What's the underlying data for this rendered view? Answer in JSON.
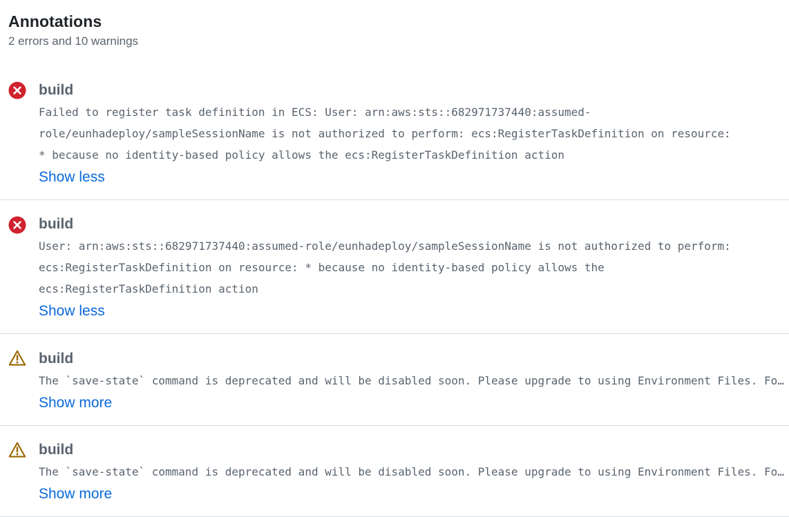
{
  "header": {
    "title": "Annotations",
    "summary": "2 errors and 10 warnings"
  },
  "colors": {
    "error": "#cf222e",
    "warning": "#9a6700",
    "link": "#0969da",
    "muted": "#59636e",
    "divider": "#d8dee4"
  },
  "annotations": [
    {
      "level": "error",
      "icon": "x-circle-fill-icon",
      "name": "build",
      "message_lines": [
        "Failed to register task definition in ECS: User: arn:aws:sts::682971737440:assumed-",
        "role/eunhadeploy/sampleSessionName is not authorized to perform: ecs:RegisterTaskDefinition on resource:",
        "* because no identity-based policy allows the ecs:RegisterTaskDefinition action"
      ],
      "toggle": "Show less"
    },
    {
      "level": "error",
      "icon": "x-circle-fill-icon",
      "name": "build",
      "message_lines": [
        "User: arn:aws:sts::682971737440:assumed-role/eunhadeploy/sampleSessionName is not authorized to perform:",
        "ecs:RegisterTaskDefinition on resource: * because no identity-based policy allows the",
        "ecs:RegisterTaskDefinition action"
      ],
      "toggle": "Show less"
    },
    {
      "level": "warning",
      "icon": "alert-triangle-icon",
      "name": "build",
      "message": "The `save-state` command is deprecated and will be disabled soon. Please upgrade to using Environment Files. For more information see: https://github.blog/changelog/2022-10-11-github-actions-deprecating-save-state-and-set-output-commands/",
      "toggle": "Show more"
    },
    {
      "level": "warning",
      "icon": "alert-triangle-icon",
      "name": "build",
      "message": "The `save-state` command is deprecated and will be disabled soon. Please upgrade to using Environment Files. For more information see: https://github.blog/changelog/2022-10-11-github-actions-deprecating-save-state-and-set-output-commands/",
      "toggle": "Show more"
    }
  ]
}
